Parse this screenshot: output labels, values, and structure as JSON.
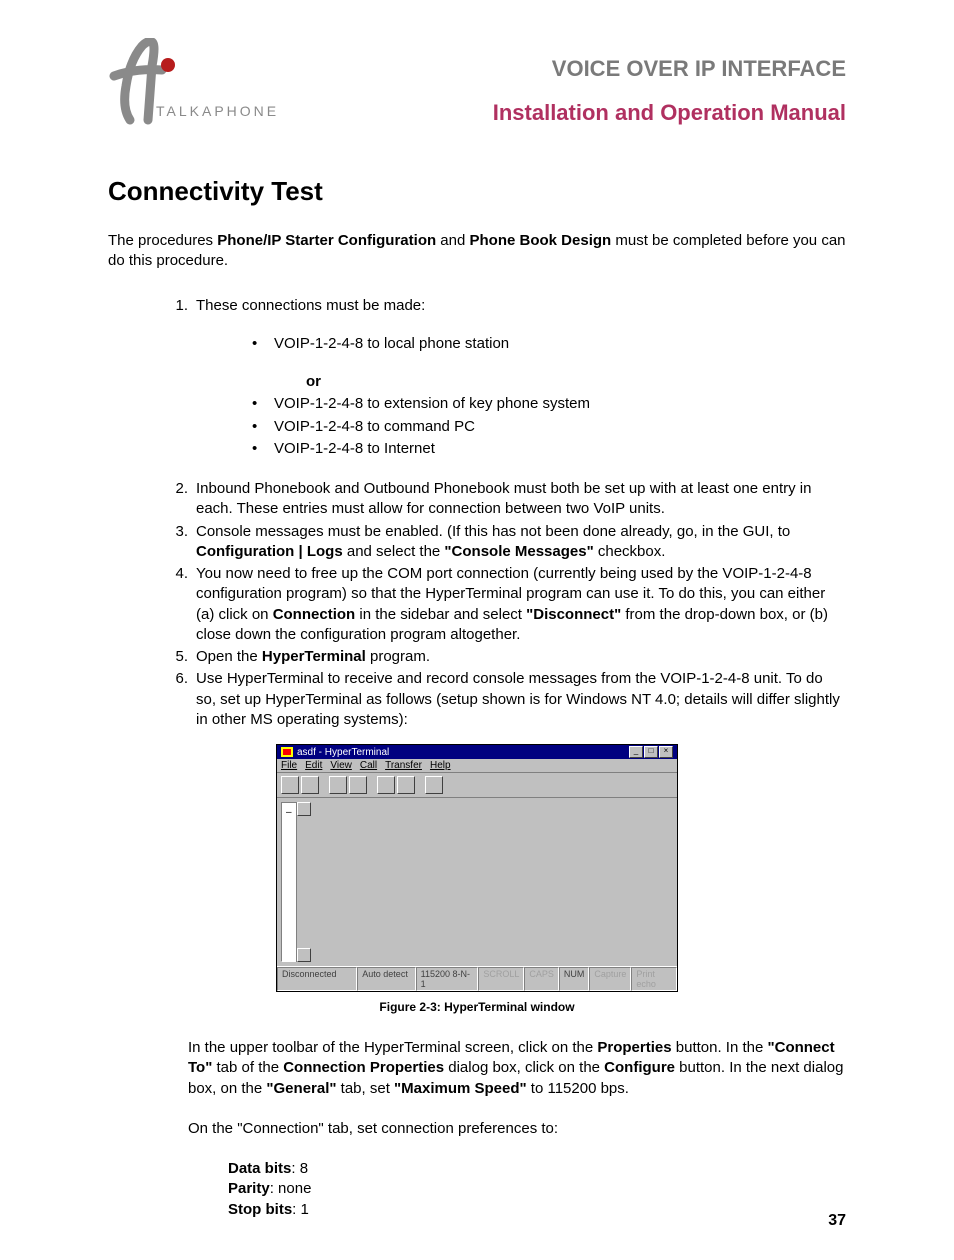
{
  "header": {
    "brand": "TALKAPHONE",
    "title1": "VOICE OVER IP INTERFACE",
    "title2": "Installation and Operation Manual"
  },
  "section_heading": "Connectivity Test",
  "intro": {
    "t1": "The procedures ",
    "b1": "Phone/IP Starter Configuration",
    "t2": " and ",
    "b2": "Phone Book Design",
    "t3": " must be completed before you can do this procedure."
  },
  "list": {
    "i1": {
      "num": "1.",
      "text": "These connections must be made:",
      "sub": {
        "a": "VOIP-1-2-4-8 to local phone station",
        "or": "or",
        "b": "VOIP-1-2-4-8 to extension of key phone system",
        "c": "VOIP-1-2-4-8 to command PC",
        "d": "VOIP-1-2-4-8 to Internet"
      }
    },
    "i2": {
      "num": "2.",
      "text": "Inbound Phonebook and Outbound Phonebook must both be set up with at least one entry in each.  These entries must allow for connection between two VoIP units."
    },
    "i3": {
      "num": "3.",
      "t1": "Console messages must be enabled.  (If this has not been done already, go, in the GUI, to ",
      "b1": "Configuration | Logs",
      "t2": " and select the ",
      "b2": "\"Console Messages\"",
      "t3": " checkbox."
    },
    "i4": {
      "num": "4.",
      "t1": "You now need to free up the COM port connection (currently being used by the VOIP-1-2-4-8 configuration program) so that the HyperTerminal program can use it.  To do this, you can either (a) click on ",
      "b1": "Connection",
      "t2": " in the sidebar and select ",
      "b2": "\"Disconnect\"",
      "t3": " from the drop-down box, or (b) close down the configuration program altogether."
    },
    "i5": {
      "num": "5.",
      "t1": "Open the ",
      "b1": "HyperTerminal",
      "t2": " program."
    },
    "i6": {
      "num": "6.",
      "text": "Use HyperTerminal to receive and record console messages from the VOIP-1-2-4-8 unit.  To do so, set up HyperTerminal as follows (setup shown is for Windows NT 4.0; details will differ slightly in other MS operating systems):"
    }
  },
  "hyperterminal": {
    "title": "asdf - HyperTerminal",
    "menu": {
      "file": "File",
      "edit": "Edit",
      "view": "View",
      "call": "Call",
      "transfer": "Transfer",
      "help": "Help"
    },
    "status": {
      "s1": "Disconnected",
      "s2": "Auto detect",
      "s3": "115200 8-N-1",
      "s4": "SCROLL",
      "s5": "CAPS",
      "s6": "NUM",
      "s7": "Capture",
      "s8": "Print echo"
    }
  },
  "figure_caption": "Figure 2-3:  HyperTerminal window",
  "after_fig": {
    "p1": {
      "t1": "In the upper toolbar of the HyperTerminal screen, click on the ",
      "b1": "Properties",
      "t2": " button.  In the ",
      "b2": "\"Connect To\"",
      "t3": " tab of the ",
      "b3": "Connection Properties",
      "t4": " dialog box, click on the ",
      "b4": "Configure",
      "t5": " button.  In the next dialog box, on the ",
      "b5": "\"General\"",
      "t6": " tab, set ",
      "b6": "\"Maximum Speed\"",
      "t7": " to 115200 bps."
    },
    "p2": "On the \"Connection\" tab, set connection preferences to:",
    "prefs": {
      "l1": "Data bits",
      "v1": ":  8",
      "l2": "Parity",
      "v2": ":  none",
      "l3": "Stop bits",
      "v3": ":  1"
    }
  },
  "page_number": "37"
}
